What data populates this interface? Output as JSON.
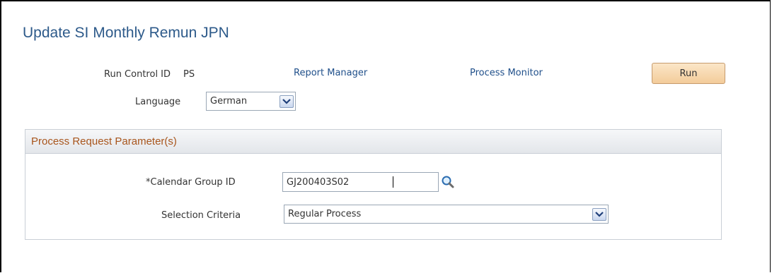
{
  "page": {
    "title": "Update SI Monthly Remun JPN"
  },
  "run_control": {
    "label": "Run Control ID",
    "value": "PS"
  },
  "links": {
    "report_manager": "Report Manager",
    "process_monitor": "Process Monitor"
  },
  "run_button": {
    "label": "Run"
  },
  "language": {
    "label": "Language",
    "selected": "German"
  },
  "section": {
    "title": "Process Request Parameter(s)"
  },
  "calendar_group": {
    "label": "*Calendar Group ID",
    "value": "GJ200403S02"
  },
  "selection_criteria": {
    "label": "Selection Criteria",
    "selected": "Regular Process"
  },
  "icons": {
    "lookup": "magnifier-icon",
    "dropdown": "chevron-down-icon"
  },
  "colors": {
    "title": "#2d5a8a",
    "link": "#1f4f8a",
    "section_title": "#a8551c",
    "run_button_bg": "#f3cc9a"
  }
}
